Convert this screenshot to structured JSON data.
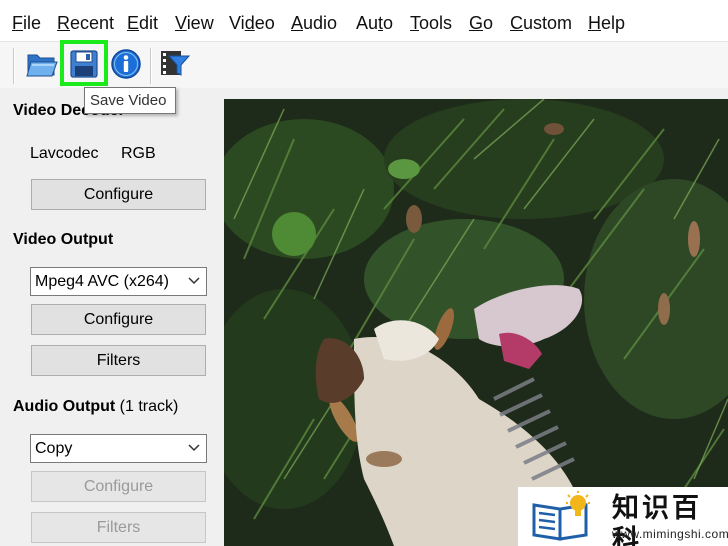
{
  "menubar": {
    "items": [
      {
        "label": "File",
        "underline": "F",
        "rest": "ile"
      },
      {
        "label": "Recent",
        "underline": "R",
        "rest": "ecent"
      },
      {
        "label": "Edit",
        "underline": "E",
        "rest": "dit"
      },
      {
        "label": "View",
        "underline": "V",
        "rest": "iew"
      },
      {
        "label": "Video",
        "pre": "Vi",
        "underline": "d",
        "rest": "eo"
      },
      {
        "label": "Audio",
        "underline": "A",
        "rest": "udio"
      },
      {
        "label": "Auto",
        "pre": "Au",
        "underline": "t",
        "rest": "o"
      },
      {
        "label": "Tools",
        "underline": "T",
        "rest": "ools"
      },
      {
        "label": "Go",
        "underline": "G",
        "rest": "o"
      },
      {
        "label": "Custom",
        "underline": "C",
        "rest": "ustom"
      },
      {
        "label": "Help",
        "underline": "H",
        "rest": "elp"
      }
    ]
  },
  "toolbar": {
    "icons": [
      "open-folder-icon",
      "save-video-icon",
      "info-icon",
      "filter-icon"
    ],
    "highlight_color": "#1bea1b",
    "tooltip": "Save Video"
  },
  "video_decoder": {
    "title": "Video Decoder",
    "codec": "Lavcodec",
    "format": "RGB",
    "configure_label": "Configure"
  },
  "video_output": {
    "title": "Video Output",
    "selected": "Mpeg4 AVC (x264)",
    "configure_label": "Configure",
    "filters_label": "Filters"
  },
  "audio_output": {
    "title": "Audio Output",
    "track_info": "(1 track)",
    "selected": "Copy",
    "configure_label": "Configure",
    "filters_label": "Filters"
  },
  "watermark": {
    "title": "知识百科",
    "url": "www.mimingshi.com"
  }
}
